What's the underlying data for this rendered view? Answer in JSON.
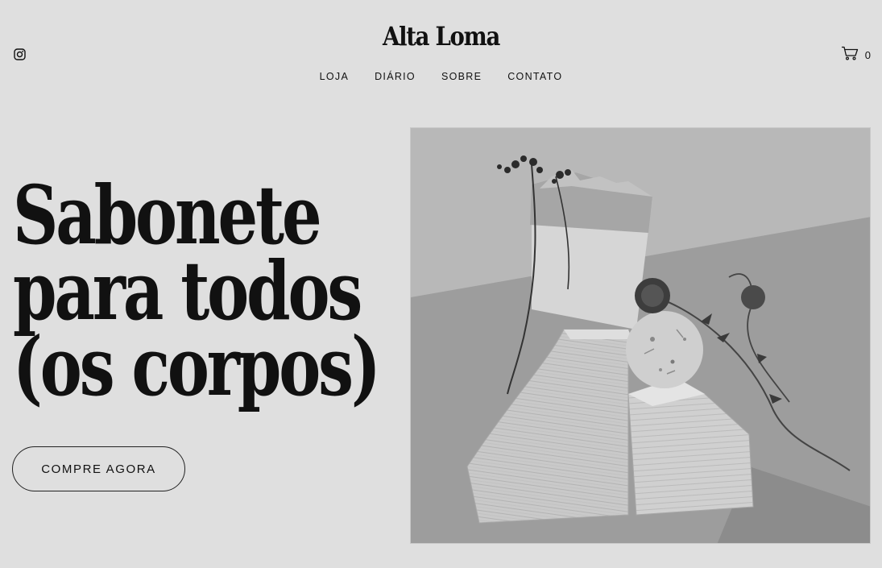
{
  "brand": {
    "name": "Alta Loma"
  },
  "header": {
    "social_icon": "instagram-icon",
    "cart_icon": "shopping-cart-icon",
    "cart_count": "0"
  },
  "nav": {
    "items": [
      {
        "label": "LOJA"
      },
      {
        "label": "DIÁRIO"
      },
      {
        "label": "SOBRE"
      },
      {
        "label": "CONTATO"
      }
    ]
  },
  "hero": {
    "headline_lines": [
      "Sabonete",
      "para todos",
      "(os corpos)"
    ],
    "cta_label": "COMPRE AGORA"
  },
  "colors": {
    "background": "#dfdfdf",
    "text": "#111111"
  }
}
